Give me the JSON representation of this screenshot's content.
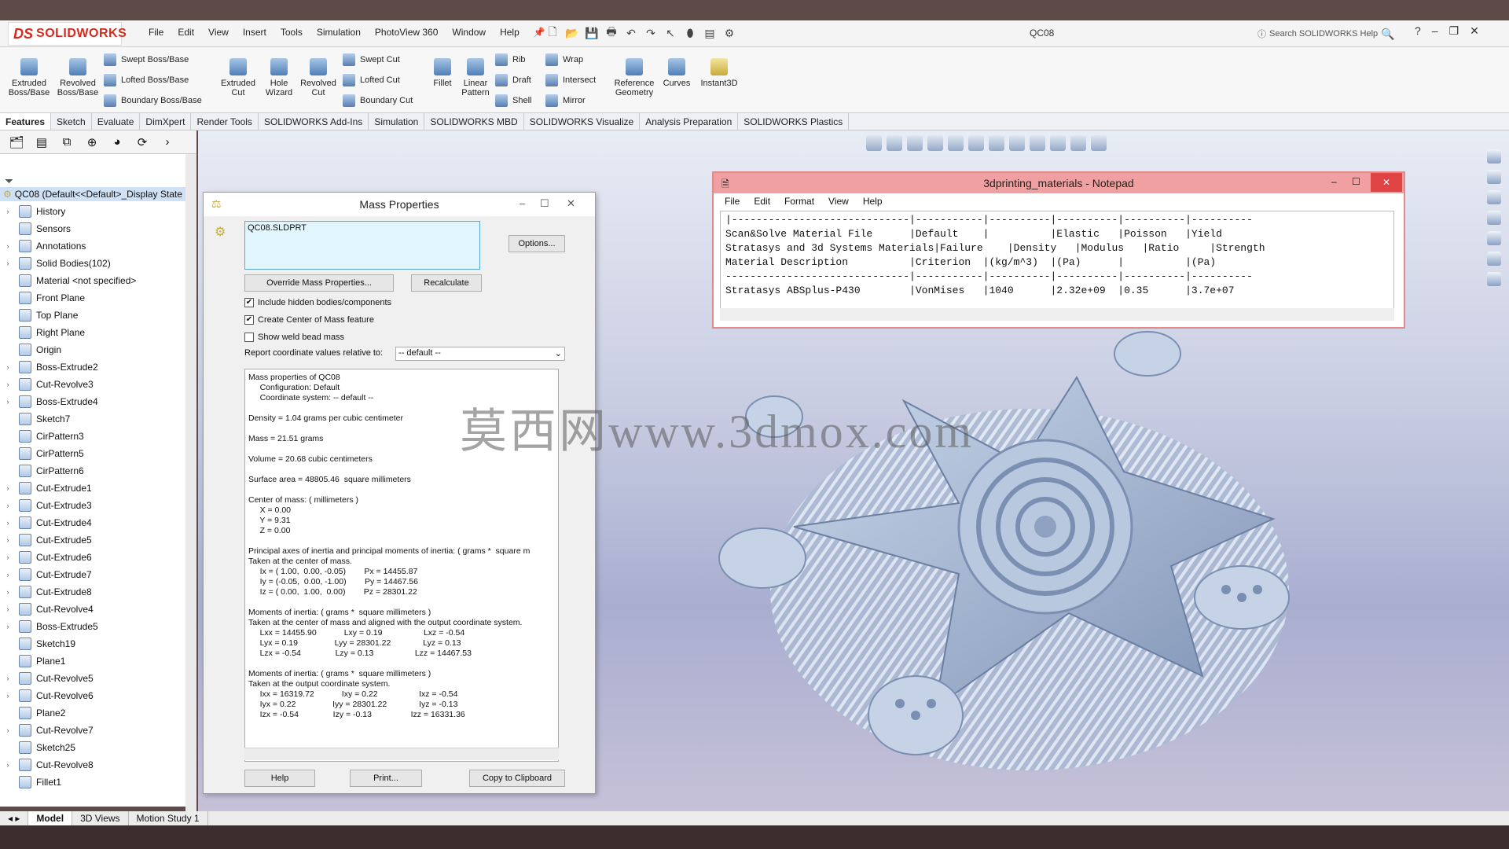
{
  "app": {
    "logo": "SOLIDWORKS",
    "logo_ds": "DS",
    "document_title": "QC08",
    "search_placeholder": "Search SOLIDWORKS Help",
    "menu": [
      "File",
      "Edit",
      "View",
      "Insert",
      "Tools",
      "Simulation",
      "PhotoView 360",
      "Window",
      "Help"
    ]
  },
  "ribbon": {
    "extruded_boss": "Extruded\nBoss/Base",
    "revolved_boss": "Revolved\nBoss/Base",
    "swept_boss": "Swept Boss/Base",
    "lofted_boss": "Lofted Boss/Base",
    "boundary_boss": "Boundary Boss/Base",
    "extruded_cut": "Extruded\nCut",
    "hole_wizard": "Hole\nWizard",
    "revolved_cut": "Revolved\nCut",
    "swept_cut": "Swept Cut",
    "lofted_cut": "Lofted Cut",
    "boundary_cut": "Boundary Cut",
    "fillet": "Fillet",
    "linear_pattern": "Linear\nPattern",
    "rib": "Rib",
    "draft": "Draft",
    "shell": "Shell",
    "wrap": "Wrap",
    "intersect": "Intersect",
    "mirror": "Mirror",
    "reference_geometry": "Reference\nGeometry",
    "curves": "Curves",
    "instant3d": "Instant3D"
  },
  "tabs": [
    "Features",
    "Sketch",
    "Evaluate",
    "DimXpert",
    "Render Tools",
    "SOLIDWORKS Add-Ins",
    "Simulation",
    "SOLIDWORKS MBD",
    "SOLIDWORKS Visualize",
    "Analysis Preparation",
    "SOLIDWORKS Plastics"
  ],
  "feature_tree": {
    "root": "QC08  (Default<<Default>_Display State",
    "items": [
      {
        "label": "History",
        "exp": "›"
      },
      {
        "label": "Sensors",
        "exp": ""
      },
      {
        "label": "Annotations",
        "exp": "›"
      },
      {
        "label": "Solid Bodies(102)",
        "exp": "›"
      },
      {
        "label": "Material <not specified>",
        "exp": ""
      },
      {
        "label": "Front Plane",
        "exp": ""
      },
      {
        "label": "Top Plane",
        "exp": ""
      },
      {
        "label": "Right Plane",
        "exp": ""
      },
      {
        "label": "Origin",
        "exp": ""
      },
      {
        "label": "Boss-Extrude2",
        "exp": "›"
      },
      {
        "label": "Cut-Revolve3",
        "exp": "›"
      },
      {
        "label": "Boss-Extrude4",
        "exp": "›"
      },
      {
        "label": "Sketch7",
        "exp": ""
      },
      {
        "label": "CirPattern3",
        "exp": ""
      },
      {
        "label": "CirPattern5",
        "exp": ""
      },
      {
        "label": "CirPattern6",
        "exp": ""
      },
      {
        "label": "Cut-Extrude1",
        "exp": "›"
      },
      {
        "label": "Cut-Extrude3",
        "exp": "›"
      },
      {
        "label": "Cut-Extrude4",
        "exp": "›"
      },
      {
        "label": "Cut-Extrude5",
        "exp": "›"
      },
      {
        "label": "Cut-Extrude6",
        "exp": "›"
      },
      {
        "label": "Cut-Extrude7",
        "exp": "›"
      },
      {
        "label": "Cut-Extrude8",
        "exp": "›"
      },
      {
        "label": "Cut-Revolve4",
        "exp": "›"
      },
      {
        "label": "Boss-Extrude5",
        "exp": "›"
      },
      {
        "label": "Sketch19",
        "exp": ""
      },
      {
        "label": "Plane1",
        "exp": ""
      },
      {
        "label": "Cut-Revolve5",
        "exp": "›"
      },
      {
        "label": "Cut-Revolve6",
        "exp": "›"
      },
      {
        "label": "Plane2",
        "exp": ""
      },
      {
        "label": "Cut-Revolve7",
        "exp": "›"
      },
      {
        "label": "Sketch25",
        "exp": ""
      },
      {
        "label": "Cut-Revolve8",
        "exp": "›"
      },
      {
        "label": "Fillet1",
        "exp": ""
      }
    ]
  },
  "bottom_tabs": [
    "Model",
    "3D Views",
    "Motion Study 1"
  ],
  "mass_properties": {
    "title": "Mass Properties",
    "file": "QC08.SLDPRT",
    "options": "Options...",
    "override": "Override Mass Properties...",
    "recalculate": "Recalculate",
    "include_hidden": "Include hidden bodies/components",
    "create_com": "Create Center of Mass feature",
    "show_weld": "Show weld bead mass",
    "report_label": "Report coordinate values relative to:",
    "report_value": "-- default --",
    "help": "Help",
    "print": "Print...",
    "copy": "Copy to Clipboard",
    "text": "Mass properties of QC08\n     Configuration: Default\n     Coordinate system: -- default --\n\nDensity = 1.04 grams per cubic centimeter\n\nMass = 21.51 grams\n\nVolume = 20.68 cubic centimeters\n\nSurface area = 48805.46  square millimeters\n\nCenter of mass: ( millimeters )\n     X = 0.00\n     Y = 9.31\n     Z = 0.00\n\nPrincipal axes of inertia and principal moments of inertia: ( grams *  square m\nTaken at the center of mass.\n     Ix = ( 1.00,  0.00, -0.05)        Px = 14455.87\n     Iy = (-0.05,  0.00, -1.00)        Py = 14467.56\n     Iz = ( 0.00,  1.00,  0.00)        Pz = 28301.22\n\nMoments of inertia: ( grams *  square millimeters )\nTaken at the center of mass and aligned with the output coordinate system.\n     Lxx = 14455.90            Lxy = 0.19                  Lxz = -0.54\n     Lyx = 0.19                Lyy = 28301.22              Lyz = 0.13\n     Lzx = -0.54               Lzy = 0.13                  Lzz = 14467.53\n\nMoments of inertia: ( grams *  square millimeters )\nTaken at the output coordinate system.\n     Ixx = 16319.72            Ixy = 0.22                  Ixz = -0.54\n     Iyx = 0.22                Iyy = 28301.22              Iyz = -0.13\n     Izx = -0.54               Izy = -0.13                 Izz = 16331.36"
  },
  "notepad": {
    "title": "3dprinting_materials - Notepad",
    "menu": [
      "File",
      "Edit",
      "Format",
      "View",
      "Help"
    ],
    "content": "|-----------------------------|-----------|----------|----------|----------|----------\nScan&Solve Material File      |Default    |          |Elastic   |Poisson   |Yield\nStratasys and 3d Systems Materials|Failure    |Density   |Modulus   |Ratio     |Strength\nMaterial Description          |Criterion  |(kg/m^3)  |(Pa)      |          |(Pa)\n------------------------------|-----------|----------|----------|----------|----------\nStratasys ABSplus-P430        |VonMises   |1040      |2.32e+09  |0.35      |3.7e+07"
  },
  "watermark": "莫西网www.3dmox.com",
  "colors": {
    "accent": "#d52b1e",
    "notepad_title": "#f0a0a0",
    "selection": "#cfe1f5"
  }
}
